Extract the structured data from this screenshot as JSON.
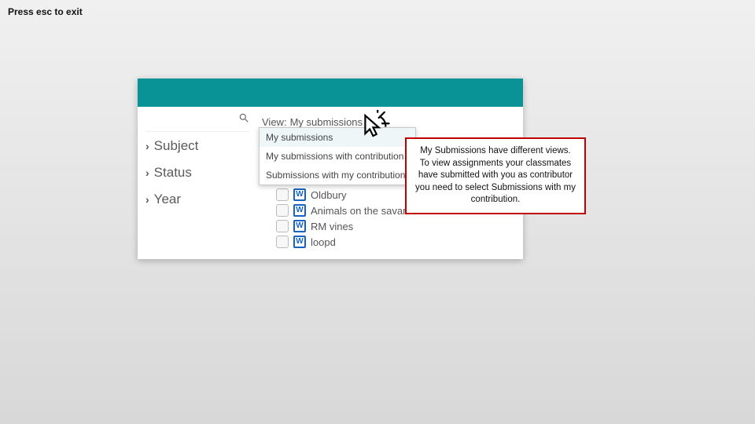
{
  "hint": "Press esc to exit",
  "view": {
    "label": "View:",
    "current": "My submissions",
    "options": [
      "My submissions",
      "My submissions with contribution",
      "Submissions with my contribution"
    ]
  },
  "facets": [
    "Subject",
    "Status",
    "Year"
  ],
  "items": [
    "Oldbury",
    "Animals on the savanna",
    "RM vines",
    "loopd"
  ],
  "w_glyph": "W",
  "callout": "My Submissions have different views. To view assignments your classmates have submitted with you as contributor you need to select Submissions with my contribution."
}
